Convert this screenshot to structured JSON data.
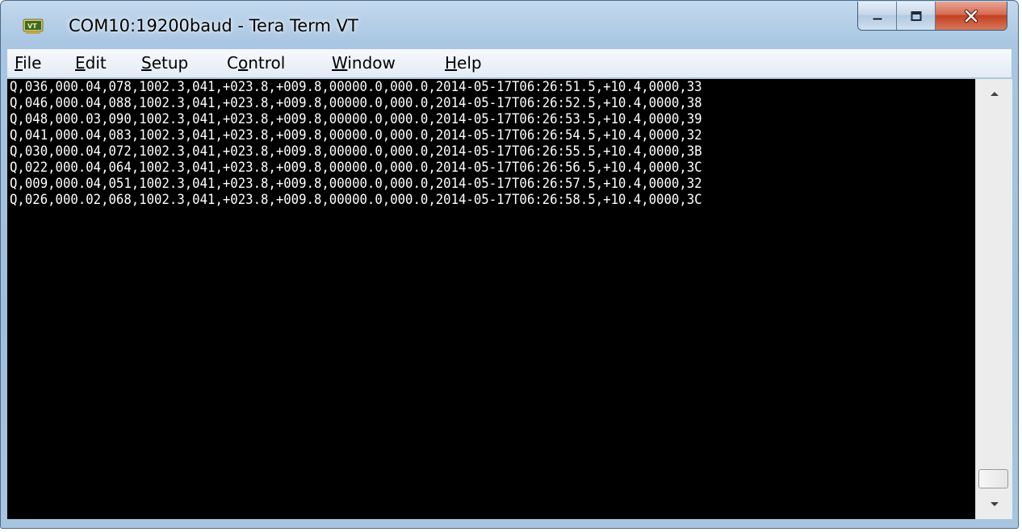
{
  "window": {
    "title": "COM10:19200baud - Tera Term VT",
    "app_icon": "teraterm-vt-icon",
    "buttons": {
      "minimize": "minimize-icon",
      "maximize": "maximize-icon",
      "close": "close-icon"
    }
  },
  "menu": {
    "items": [
      {
        "label": "File",
        "underline": "F"
      },
      {
        "label": "Edit",
        "underline": "E"
      },
      {
        "label": "Setup",
        "underline": "S"
      },
      {
        "label": "Control",
        "underline": "o"
      },
      {
        "label": "Window",
        "underline": "W"
      },
      {
        "label": "Help",
        "underline": "H"
      }
    ]
  },
  "terminal": {
    "lines": [
      "Q,036,000.04,078,1002.3,041,+023.8,+009.8,00000.0,000.0,2014-05-17T06:26:51.5,+10.4,0000,33",
      "Q,046,000.04,088,1002.3,041,+023.8,+009.8,00000.0,000.0,2014-05-17T06:26:52.5,+10.4,0000,38",
      "Q,048,000.03,090,1002.3,041,+023.8,+009.8,00000.0,000.0,2014-05-17T06:26:53.5,+10.4,0000,39",
      "Q,041,000.04,083,1002.3,041,+023.8,+009.8,00000.0,000.0,2014-05-17T06:26:54.5,+10.4,0000,32",
      "Q,030,000.04,072,1002.3,041,+023.8,+009.8,00000.0,000.0,2014-05-17T06:26:55.5,+10.4,0000,3B",
      "Q,022,000.04,064,1002.3,041,+023.8,+009.8,00000.0,000.0,2014-05-17T06:26:56.5,+10.4,0000,3C",
      "Q,009,000.04,051,1002.3,041,+023.8,+009.8,00000.0,000.0,2014-05-17T06:26:57.5,+10.4,0000,32",
      "Q,026,000.02,068,1002.3,041,+023.8,+009.8,00000.0,000.0,2014-05-17T06:26:58.5,+10.4,0000,3C"
    ],
    "background_color": "#000000",
    "text_color": "#FFFFFF"
  },
  "scrollbar": {
    "position": 1.0,
    "up_icon": "scroll-up-arrow-icon",
    "down_icon": "scroll-down-arrow-icon"
  }
}
